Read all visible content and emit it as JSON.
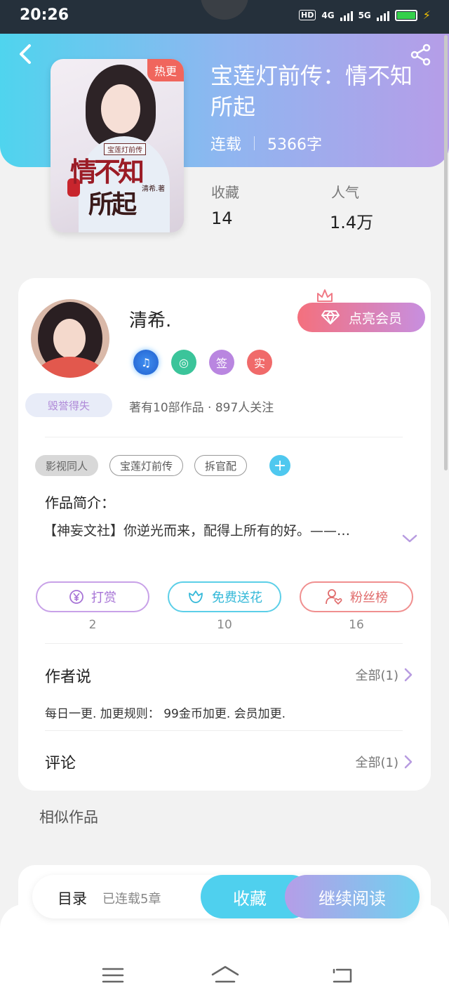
{
  "status_bar": {
    "time": "20:26",
    "network1": "4G",
    "network2": "5G"
  },
  "header": {
    "hot_badge": "热更",
    "title": "宝莲灯前传：情不知所起",
    "status": "连载",
    "word_count": "5366字"
  },
  "cover": {
    "subtitle": "宝莲灯前传",
    "title_line1": "情不知",
    "title_line2": "所起",
    "author": "清希.著"
  },
  "stats": {
    "favorites_label": "收藏",
    "favorites_value": "14",
    "popularity_label": "人气",
    "popularity_value": "1.4万"
  },
  "author": {
    "name": "清希.",
    "member_button": "点亮会员",
    "badges": [
      "签",
      "实"
    ],
    "fame_tag": "毁誉得失",
    "stats_text": "著有10部作品 · 897人关注"
  },
  "tags": [
    "影视同人",
    "宝莲灯前传",
    "拆官配"
  ],
  "tag_add": "+",
  "synopsis": {
    "label": "作品简介：",
    "text": "【神妄文社】你逆光而来，配得上所有的好。——…"
  },
  "actions": [
    {
      "label": "打赏",
      "count": "2"
    },
    {
      "label": "免费送花",
      "count": "10"
    },
    {
      "label": "粉丝榜",
      "count": "16"
    }
  ],
  "author_says": {
    "title": "作者说",
    "more": "全部(1)",
    "content": "每日一更. 加更规则： 99金币加更. 会员加更."
  },
  "comments": {
    "title": "评论",
    "more": "全部(1)"
  },
  "similar": {
    "title": "相似作品"
  },
  "bottom_bar": {
    "toc": "目录",
    "serial_status": "已连载5章",
    "collect": "收藏",
    "continue_reading": "继续阅读"
  },
  "colors": {
    "accent_cyan": "#4fd0ee",
    "accent_purple": "#b69de8",
    "hot_red": "#f0665d"
  }
}
